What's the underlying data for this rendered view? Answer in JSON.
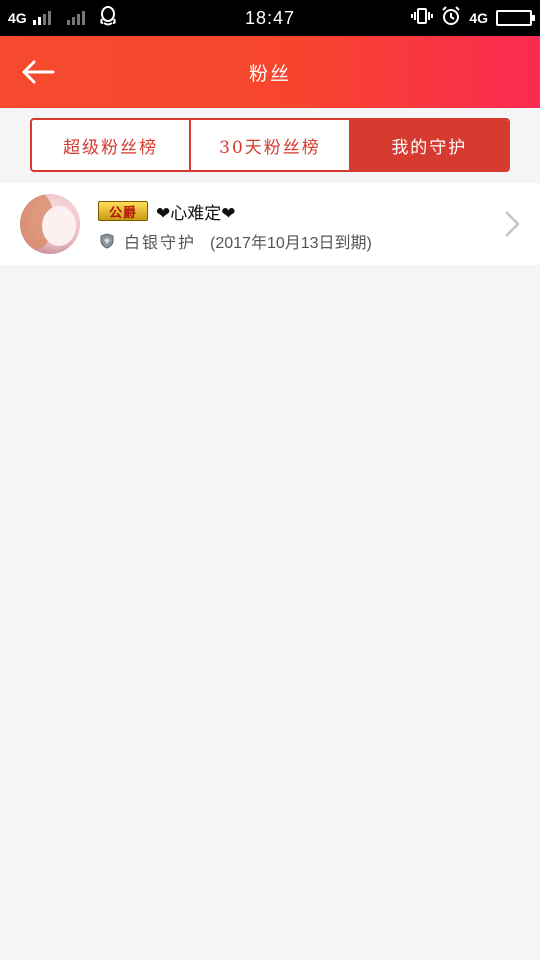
{
  "status_bar": {
    "network_left": "4G",
    "time": "18:47",
    "network_right": "4G"
  },
  "header": {
    "title": "粉丝",
    "back_icon": "arrow-left-icon"
  },
  "tabs": [
    {
      "label": "超级粉丝榜",
      "active": false
    },
    {
      "label": "30天粉丝榜",
      "active": false
    },
    {
      "label": "我的守护",
      "active": true
    }
  ],
  "list": {
    "items": [
      {
        "badge": "公爵",
        "nickname": "❤心难定❤",
        "guard_level": "白银守护",
        "expiry": "(2017年10月13日到期)"
      }
    ]
  },
  "colors": {
    "accent": "#d73a2f",
    "header_start": "#f64b2f",
    "header_end": "#fa2a52",
    "background": "#f5f5f5"
  }
}
